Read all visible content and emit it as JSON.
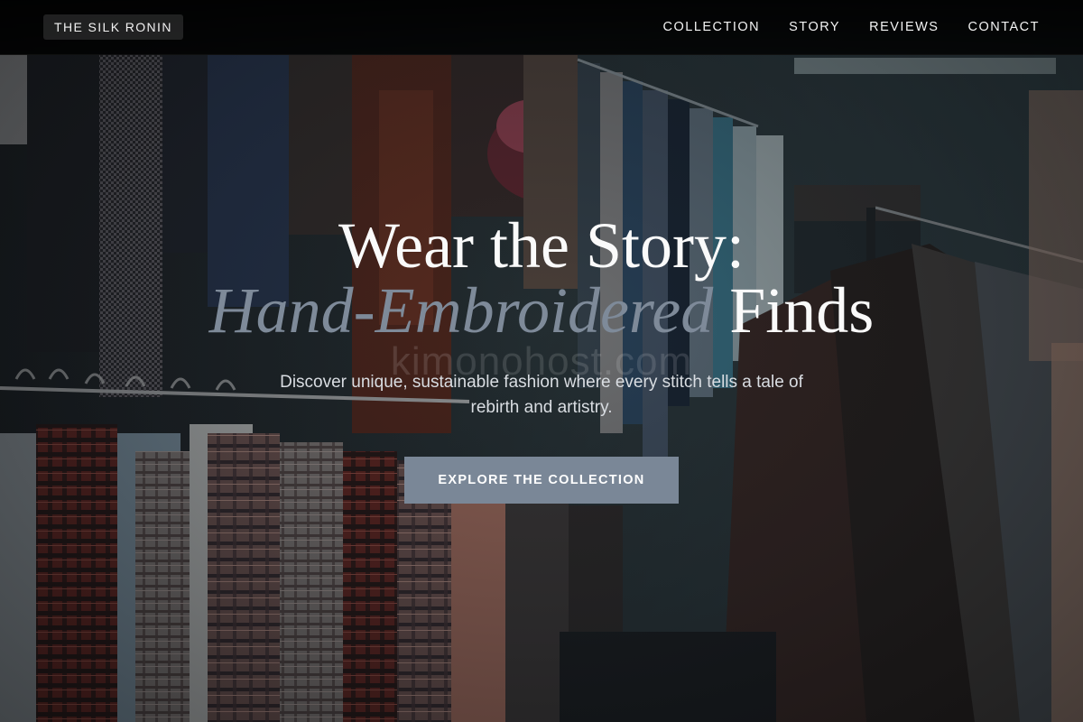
{
  "header": {
    "brand": "THE SILK RONIN",
    "nav": [
      {
        "label": "COLLECTION"
      },
      {
        "label": "STORY"
      },
      {
        "label": "REVIEWS"
      },
      {
        "label": "CONTACT"
      }
    ]
  },
  "hero": {
    "headline_line1": "Wear the Story:",
    "headline_emphasis": "Hand-Embroidered",
    "headline_rest": " Finds",
    "subtitle": "Discover unique, sustainable fashion where every stitch tells a tale of rebirth and artistry.",
    "cta_label": "EXPLORE THE COLLECTION",
    "watermark": "kimonohost.com"
  },
  "colors": {
    "accent": "#7a8797",
    "headline_emphasis": "#7e8a99",
    "header_bg": "#000000"
  }
}
